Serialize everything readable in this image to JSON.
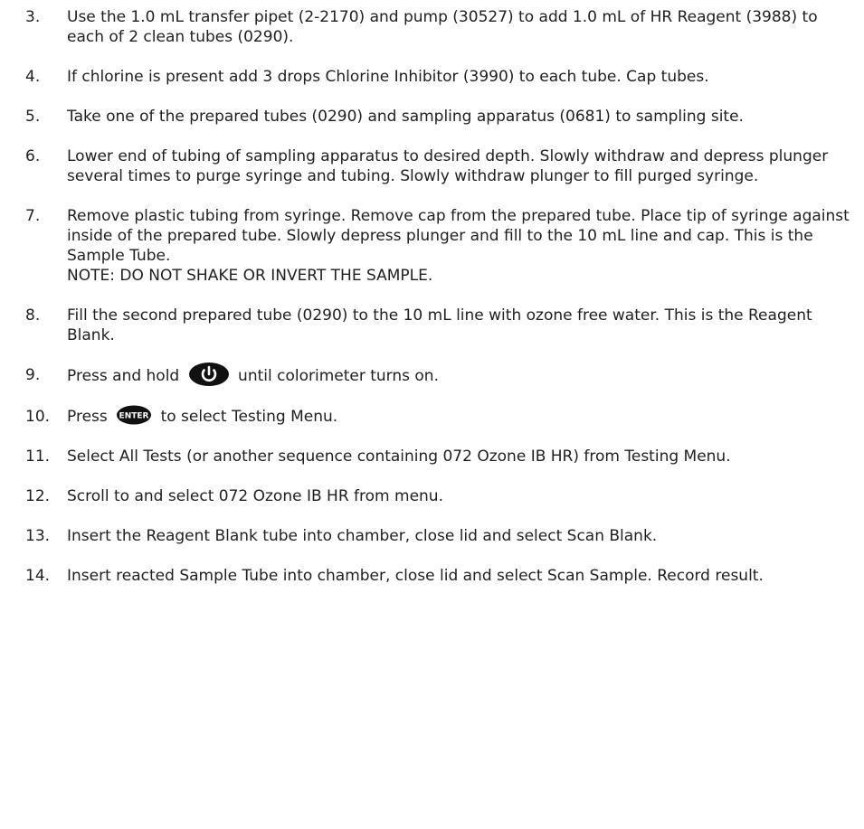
{
  "steps": [
    {
      "num": "3.",
      "text": "Use the 1.0 mL transfer pipet (2-2170) and pump (30527) to add 1.0 mL of HR Reagent (3988) to each of 2 clean tubes (0290)."
    },
    {
      "num": "4.",
      "text": "If chlorine is present add 3 drops Chlorine Inhibitor (3990) to each tube. Cap tubes."
    },
    {
      "num": "5.",
      "text": "Take one of the prepared tubes (0290) and sampling apparatus (0681) to sampling site."
    },
    {
      "num": "6.",
      "text": "Lower end of tubing of sampling apparatus to desired depth. Slowly withdraw and depress plunger several times to purge syringe and tubing. Slowly withdraw plunger to fill purged syringe."
    },
    {
      "num": "7.",
      "text": "Remove plastic tubing from syringe. Remove cap from the prepared tube. Place tip of syringe against inside of the prepared tube. Slowly depress plunger and fill to the 10 mL line and cap. This is the Sample Tube.",
      "note": "NOTE: DO NOT SHAKE OR INVERT THE SAMPLE."
    },
    {
      "num": "8.",
      "text": "Fill the second prepared tube (0290) to the 10 mL line with ozone free water. This is the Reagent Blank."
    },
    {
      "num": "9.",
      "before": "Press and hold",
      "icon": "power-button-icon",
      "after": "until colorimeter turns on."
    },
    {
      "num": "10.",
      "before": "Press",
      "icon": "enter-button-icon",
      "icon_label": "ENTER",
      "after": "to select Testing Menu."
    },
    {
      "num": "11.",
      "text": "Select All Tests (or another sequence containing 072 Ozone IB HR) from Testing Menu."
    },
    {
      "num": "12.",
      "text": "Scroll to and select 072 Ozone IB HR from menu."
    },
    {
      "num": "13.",
      "text": "Insert the Reagent Blank tube into chamber, close lid and select Scan Blank."
    },
    {
      "num": "14.",
      "text": "Insert reacted Sample Tube into chamber, close lid and select Scan Sample. Record result."
    }
  ],
  "colors": {
    "text": "#1f1f1f",
    "icon_fill": "#111111",
    "icon_fg": "#ffffff"
  }
}
